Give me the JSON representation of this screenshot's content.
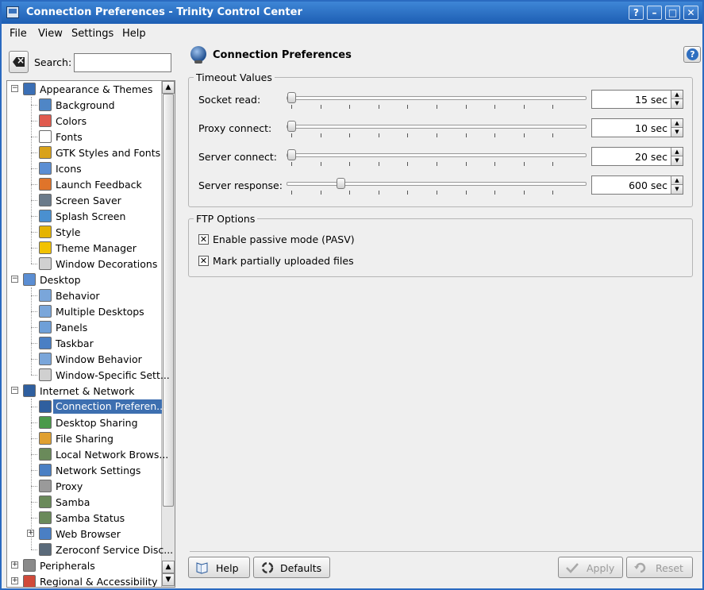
{
  "window": {
    "title": "Connection Preferences - Trinity Control Center"
  },
  "titlebar_buttons": [
    "?",
    "–",
    "□",
    "✕"
  ],
  "menu": [
    "File",
    "View",
    "Settings",
    "Help"
  ],
  "search": {
    "label": "Search:",
    "value": ""
  },
  "tree": [
    {
      "label": "Appearance & Themes",
      "level": 0,
      "expander": "−",
      "icon": "appearance-icon",
      "color": "#3b6fb5"
    },
    {
      "label": "Background",
      "level": 1,
      "icon": "background-icon",
      "color": "#4f86c6"
    },
    {
      "label": "Colors",
      "level": 1,
      "icon": "colors-icon",
      "color": "#e05a4e"
    },
    {
      "label": "Fonts",
      "level": 1,
      "icon": "fonts-icon",
      "color": "#ffffff"
    },
    {
      "label": "GTK Styles and Fonts",
      "level": 1,
      "icon": "gtk-icon",
      "color": "#d9a21a"
    },
    {
      "label": "Icons",
      "level": 1,
      "icon": "icons-icon",
      "color": "#5b8ed3"
    },
    {
      "label": "Launch Feedback",
      "level": 1,
      "icon": "launch-feedback-icon",
      "color": "#e0742a"
    },
    {
      "label": "Screen Saver",
      "level": 1,
      "icon": "screen-saver-icon",
      "color": "#6a7a8a"
    },
    {
      "label": "Splash Screen",
      "level": 1,
      "icon": "splash-screen-icon",
      "color": "#4a90d0"
    },
    {
      "label": "Style",
      "level": 1,
      "icon": "style-icon",
      "color": "#e5b400"
    },
    {
      "label": "Theme Manager",
      "level": 1,
      "icon": "theme-manager-icon",
      "color": "#f2c200"
    },
    {
      "label": "Window Decorations",
      "level": 1,
      "icon": "window-decorations-icon",
      "color": "#d0d0d0"
    },
    {
      "label": "Desktop",
      "level": 0,
      "expander": "−",
      "icon": "desktop-icon",
      "color": "#5b8ed3"
    },
    {
      "label": "Behavior",
      "level": 1,
      "icon": "behavior-icon",
      "color": "#7aa6da"
    },
    {
      "label": "Multiple Desktops",
      "level": 1,
      "icon": "multiple-desktops-icon",
      "color": "#7aa6da"
    },
    {
      "label": "Panels",
      "level": 1,
      "icon": "panels-icon",
      "color": "#6e9fd8"
    },
    {
      "label": "Taskbar",
      "level": 1,
      "icon": "taskbar-icon",
      "color": "#4a7fc4"
    },
    {
      "label": "Window Behavior",
      "level": 1,
      "icon": "window-behavior-icon",
      "color": "#7aa6da"
    },
    {
      "label": "Window-Specific Sett...",
      "level": 1,
      "icon": "window-specific-icon",
      "color": "#d0d0d0"
    },
    {
      "label": "Internet & Network",
      "level": 0,
      "expander": "−",
      "icon": "internet-network-icon",
      "color": "#2f5f9f"
    },
    {
      "label": "Connection Preferen...",
      "level": 1,
      "icon": "connection-preferences-icon",
      "color": "#2f5f9f",
      "selected": true
    },
    {
      "label": "Desktop Sharing",
      "level": 1,
      "icon": "desktop-sharing-icon",
      "color": "#4a9a4a"
    },
    {
      "label": "File Sharing",
      "level": 1,
      "icon": "file-sharing-icon",
      "color": "#e0a030"
    },
    {
      "label": "Local Network Brows...",
      "level": 1,
      "icon": "local-network-icon",
      "color": "#6a8a5a"
    },
    {
      "label": "Network Settings",
      "level": 1,
      "icon": "network-settings-icon",
      "color": "#4a7fc4"
    },
    {
      "label": "Proxy",
      "level": 1,
      "icon": "proxy-icon",
      "color": "#9a9a9a"
    },
    {
      "label": "Samba",
      "level": 1,
      "icon": "samba-icon",
      "color": "#6a8a5a"
    },
    {
      "label": "Samba Status",
      "level": 1,
      "icon": "samba-status-icon",
      "color": "#6a8a5a"
    },
    {
      "label": "Web Browser",
      "level": 1,
      "expander": "+",
      "icon": "web-browser-icon",
      "color": "#4a7fc4"
    },
    {
      "label": "Zeroconf Service Disc...",
      "level": 1,
      "icon": "zeroconf-icon",
      "color": "#5a6a7a"
    },
    {
      "label": "Peripherals",
      "level": 0,
      "expander": "+",
      "icon": "peripherals-icon",
      "color": "#8a8a8a"
    },
    {
      "label": "Regional & Accessibility",
      "level": 0,
      "expander": "+",
      "icon": "regional-icon",
      "color": "#d04a3a"
    }
  ],
  "page": {
    "title": "Connection Preferences"
  },
  "timeout": {
    "title": "Timeout Values",
    "rows": [
      {
        "label": "Socket read:",
        "value": "15 sec",
        "level": 0.0
      },
      {
        "label": "Proxy connect:",
        "value": "10 sec",
        "level": 0.0
      },
      {
        "label": "Server connect:",
        "value": "20 sec",
        "level": 0.0
      },
      {
        "label": "Server response:",
        "value": "600 sec",
        "level": 0.17
      }
    ]
  },
  "ftp": {
    "title": "FTP Options",
    "options": [
      {
        "label": "Enable passive mode (PASV)",
        "checked": true
      },
      {
        "label": "Mark partially uploaded files",
        "checked": true
      }
    ]
  },
  "buttons": {
    "help": "Help",
    "defaults": "Defaults",
    "apply": "Apply",
    "reset": "Reset"
  }
}
